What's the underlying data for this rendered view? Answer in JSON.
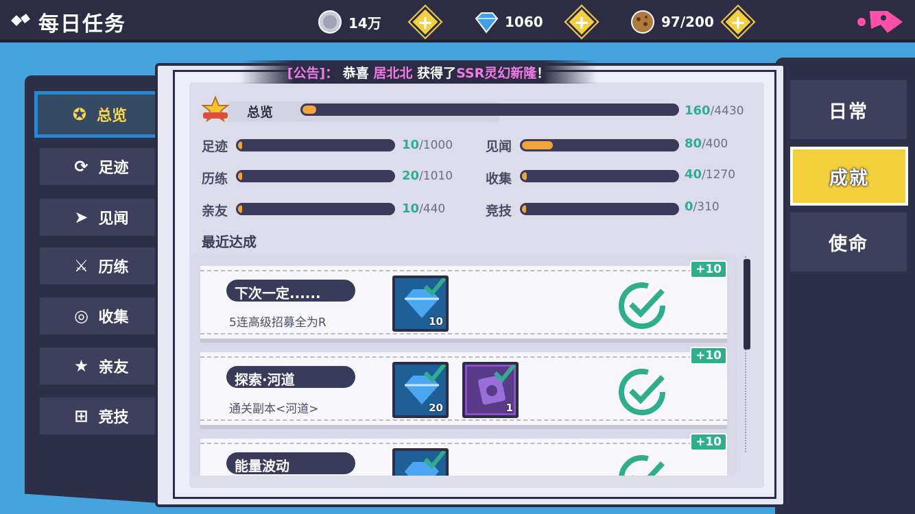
{
  "header": {
    "title": "每日任务",
    "resources": [
      {
        "icon": "silver-coin-icon",
        "value": "14万"
      },
      {
        "icon": "blue-diamond-icon",
        "value": "1060"
      },
      {
        "icon": "stamina-cookie-icon",
        "value": "97/200"
      }
    ]
  },
  "notice": {
    "prefix": "[公告]：",
    "text1": "恭喜",
    "player": "居北北",
    "text2": "获得了",
    "item": "SSR灵幻新隆",
    "suffix": "！"
  },
  "left_nav": [
    {
      "label": "总览",
      "icon": "wings-badge-icon",
      "active": true
    },
    {
      "label": "足迹",
      "icon": "footprint-icon",
      "active": false
    },
    {
      "label": "见闻",
      "icon": "paper-plane-icon",
      "active": false
    },
    {
      "label": "历练",
      "icon": "crossed-swords-icon",
      "active": false
    },
    {
      "label": "收集",
      "icon": "collection-icon",
      "active": false
    },
    {
      "label": "亲友",
      "icon": "star-icon",
      "active": false
    },
    {
      "label": "竞技",
      "icon": "gift-icon",
      "active": false
    }
  ],
  "summary": {
    "label": "总览",
    "current": "160",
    "total": "/4430",
    "progress": 0.036
  },
  "categories": [
    {
      "label": "足迹",
      "current": "10",
      "total": "/1000",
      "progress": 0.01
    },
    {
      "label": "见闻",
      "current": "80",
      "total": "/400",
      "progress": 0.2
    },
    {
      "label": "历练",
      "current": "20",
      "total": "/1010",
      "progress": 0.02
    },
    {
      "label": "收集",
      "current": "40",
      "total": "/1270",
      "progress": 0.031
    },
    {
      "label": "亲友",
      "current": "10",
      "total": "/440",
      "progress": 0.023
    },
    {
      "label": "竞技",
      "current": "0",
      "total": "/310",
      "progress": 0
    }
  ],
  "recent_title": "最近达成",
  "achievements": [
    {
      "name": "下次一定......",
      "desc": "5连高级招募全为R",
      "bonus": "+10",
      "rewards": [
        {
          "icon": "blue-diamond-icon",
          "count": "10",
          "style": "blue"
        }
      ]
    },
    {
      "name": "探索·河道",
      "desc": "通关副本<河道>",
      "bonus": "+10",
      "rewards": [
        {
          "icon": "blue-diamond-icon",
          "count": "20",
          "style": "blue"
        },
        {
          "icon": "purple-scroll-icon",
          "count": "1",
          "style": "purple"
        }
      ]
    },
    {
      "name": "能量波动",
      "desc": "",
      "bonus": "+10",
      "rewards": [
        {
          "icon": "blue-diamond-icon",
          "count": "",
          "style": "blue"
        }
      ]
    }
  ],
  "right_tabs": [
    {
      "label": "日常",
      "active": false
    },
    {
      "label": "成就",
      "active": true
    },
    {
      "label": "使命",
      "active": false
    }
  ]
}
